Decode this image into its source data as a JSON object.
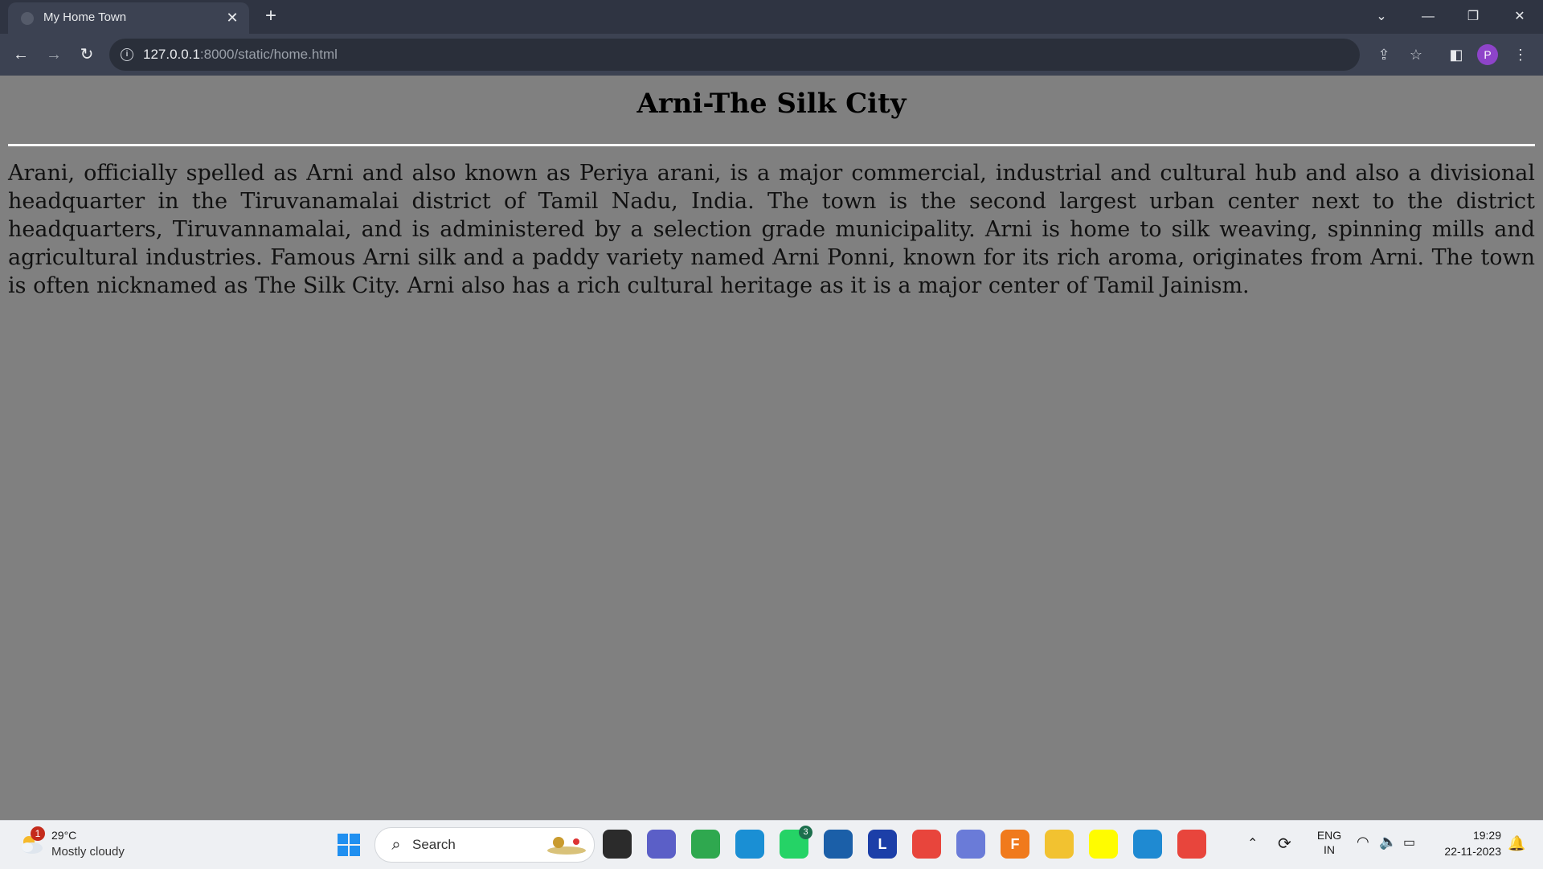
{
  "browser": {
    "tab": {
      "title": "My Home Town",
      "close": "✕"
    },
    "new_tab": "+",
    "window_controls": {
      "tab_search": "⌄",
      "minimize": "—",
      "restore": "❐",
      "close": "✕"
    },
    "nav": {
      "back": "←",
      "forward": "→",
      "reload": "↻"
    },
    "address": {
      "host": "127.0.0.1",
      "rest": ":8000/static/home.html"
    },
    "profile_initial": "P"
  },
  "page": {
    "title": "Arni-The Silk City",
    "body": "Arani, officially spelled as Arni and also known as Periya arani, is a major commercial, industrial and cultural hub and also a divisional headquarter in the Tiruvanamalai district of Tamil Nadu, India. The town is the second largest urban center next to the district headquarters, Tiruvannamalai, and is administered by a selection grade municipality. Arni is home to silk weaving, spinning mills and agricultural industries. Famous Arni silk and a paddy variety named Arni Ponni, known for its rich aroma, originates from Arni. The town is often nicknamed as The Silk City. Arni also has a rich cultural heritage as it is a major center of Tamil Jainism."
  },
  "taskbar": {
    "weather": {
      "badge": "1",
      "temp": "29°C",
      "desc": "Mostly cloudy"
    },
    "search_placeholder": "Search",
    "apps": [
      {
        "name": "task-view",
        "label": "",
        "color": "#2b2b2b"
      },
      {
        "name": "teams-chat",
        "label": "",
        "color": "#5b5fc7"
      },
      {
        "name": "loader-app",
        "label": "",
        "color": "#2fa84f"
      },
      {
        "name": "edge",
        "label": "",
        "color": "#1a8fd4"
      },
      {
        "name": "whatsapp",
        "label": "",
        "color": "#25d366",
        "badge": "3"
      },
      {
        "name": "ms-store",
        "label": "",
        "color": "#1b5fa8"
      },
      {
        "name": "l-app",
        "label": "L",
        "color": "#1c3fa8"
      },
      {
        "name": "chrome",
        "label": "",
        "color": "#e8453c"
      },
      {
        "name": "a-app",
        "label": "",
        "color": "#6a7bd8"
      },
      {
        "name": "fusion-360",
        "label": "F",
        "color": "#f07a1c"
      },
      {
        "name": "file-explorer",
        "label": "",
        "color": "#f2c230"
      },
      {
        "name": "snapchat",
        "label": "",
        "color": "#fffc00"
      },
      {
        "name": "vscode",
        "label": "",
        "color": "#1f8ad2"
      },
      {
        "name": "chrome-profile",
        "label": "",
        "color": "#e8453c"
      }
    ],
    "tray": {
      "lang_top": "ENG",
      "lang_bottom": "IN",
      "time": "19:29",
      "date": "22-11-2023"
    }
  }
}
